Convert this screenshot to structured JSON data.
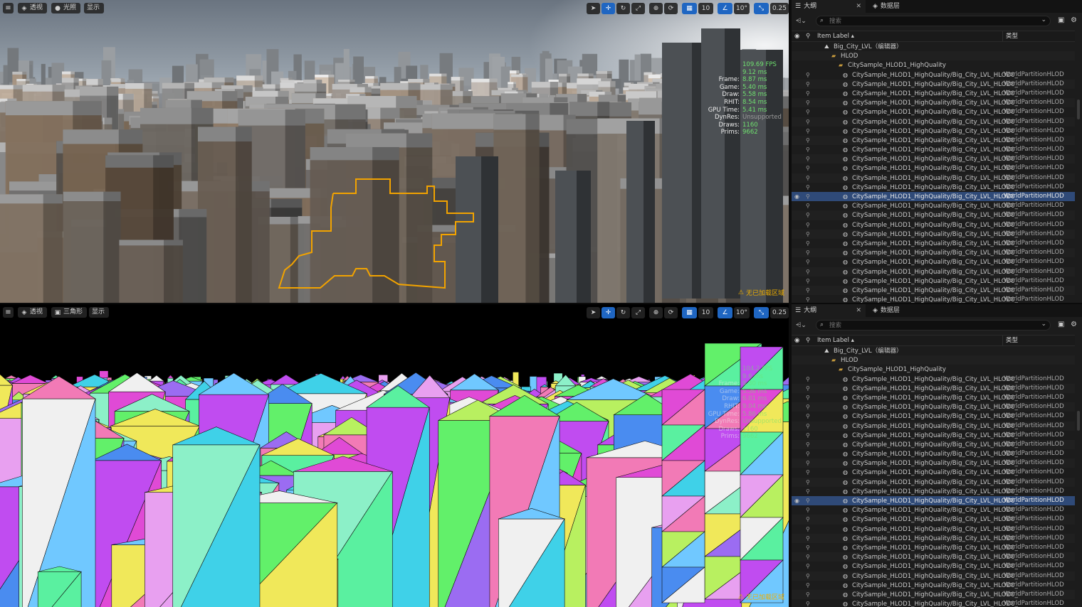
{
  "viewport_top": {
    "menu_icon": "hamburger-icon",
    "buttons": [
      {
        "label": "透视",
        "icon": "cube-icon"
      },
      {
        "label": "光照",
        "icon": "sun-icon"
      },
      {
        "label": "显示",
        "icon": ""
      }
    ],
    "tools": {
      "grid_snap": "10",
      "rotate_snap": "10°",
      "scale_snap": "0.25",
      "camera_speed": "32"
    },
    "stats": {
      "fps": "109.69 FPS",
      "ms": "9.12 ms",
      "rows": [
        {
          "label": "Frame:",
          "value": "8.87 ms"
        },
        {
          "label": "Game:",
          "value": "5.40 ms"
        },
        {
          "label": "Draw:",
          "value": "5.58 ms"
        },
        {
          "label": "RHIT:",
          "value": "8.54 ms"
        },
        {
          "label": "GPU Time:",
          "value": "5.41 ms"
        },
        {
          "label": "DynRes:",
          "value": "Unsupported"
        },
        {
          "label": "Draws:",
          "value": "1160"
        },
        {
          "label": "Prims:",
          "value": "9662"
        }
      ]
    },
    "warning": "无已加载区域"
  },
  "viewport_bottom": {
    "menu_icon": "hamburger-icon",
    "buttons": [
      {
        "label": "透视",
        "icon": "cube-icon"
      },
      {
        "label": "三角形",
        "icon": "grid-icon"
      },
      {
        "label": "显示",
        "icon": ""
      }
    ],
    "tools": {
      "grid_snap": "10",
      "rotate_snap": "10°",
      "scale_snap": "0.25",
      "camera_speed": "32"
    },
    "stats": {
      "fps": "104.2 FPS",
      "ms": "9.6 ms",
      "rows": [
        {
          "label": "Frame:",
          "value": "9.30 ms"
        },
        {
          "label": "Game:",
          "value": "5.36 ms"
        },
        {
          "label": "Draw:",
          "value": "6.01 ms"
        },
        {
          "label": "RHIT:",
          "value": "9.04 ms"
        },
        {
          "label": "GPU Time:",
          "value": "5.86 ms"
        },
        {
          "label": "DynRes:",
          "value": "Unsupported"
        },
        {
          "label": "Draws:",
          "value": "1160"
        },
        {
          "label": "Prims:",
          "value": "9662"
        }
      ]
    },
    "warning": "无已加载区域"
  },
  "outliner": {
    "tab_outline": "大纲",
    "tab_datalayers": "数据层",
    "search_placeholder": "搜索",
    "col_label": "Item Label ▴",
    "col_type": "类型",
    "level": "Big_City_LVL（编辑器）",
    "hlod_folder": "HLOD",
    "sub_folder": "CitySample_HLOD1_HighQuality",
    "item_name": "CitySample_HLOD1_HighQuality/Big_City_LVL_HLOD0_",
    "item_type": "WorldPartitionHLOD",
    "item_count": 25,
    "selected_index": 13
  }
}
